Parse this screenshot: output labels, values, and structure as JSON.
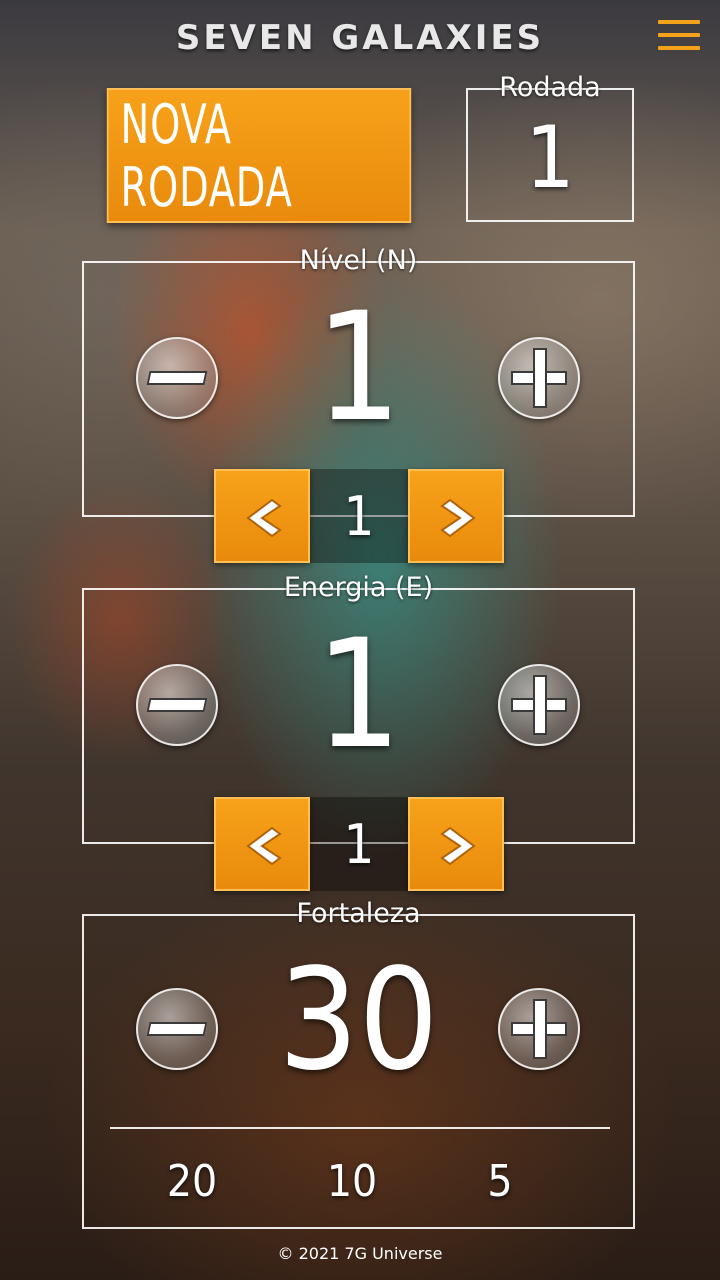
{
  "header": {
    "title": "SEVEN GALAXIES",
    "menu_icon": "hamburger-menu-icon"
  },
  "accent_color": "#f29a14",
  "new_round": {
    "label": "NOVA RODADA"
  },
  "round": {
    "label": "Rodada",
    "value": "1"
  },
  "level": {
    "label": "Nível (N)",
    "value": "1",
    "step": "1",
    "minus_icon": "minus-icon",
    "plus_icon": "plus-icon",
    "prev_icon": "chevron-left-icon",
    "next_icon": "chevron-right-icon"
  },
  "energy": {
    "label": "Energia (E)",
    "value": "1",
    "step": "1",
    "minus_icon": "minus-icon",
    "plus_icon": "plus-icon",
    "prev_icon": "chevron-left-icon",
    "next_icon": "chevron-right-icon"
  },
  "fortress": {
    "label": "Fortaleza",
    "value": "30",
    "minus_icon": "minus-icon",
    "plus_icon": "plus-icon",
    "quick_values": [
      "20",
      "10",
      "5"
    ]
  },
  "footer": {
    "copyright": "© 2021 7G Universe"
  }
}
